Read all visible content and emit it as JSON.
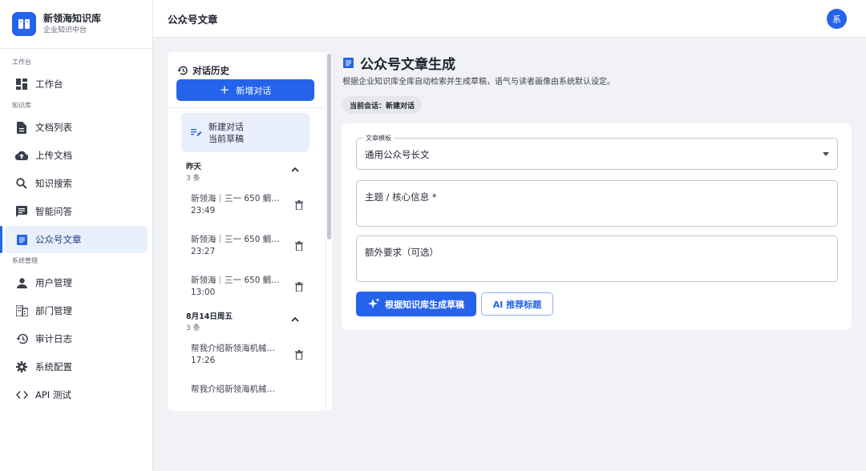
{
  "brand": {
    "name": "新领海知识库",
    "subtitle": "企业知识中台"
  },
  "sidebar": {
    "sections": [
      {
        "label": "工作台",
        "items": [
          {
            "label": "工作台",
            "icon": "dashboard-icon"
          }
        ]
      },
      {
        "label": "知识库",
        "items": [
          {
            "label": "文档列表",
            "icon": "document-icon"
          },
          {
            "label": "上传文档",
            "icon": "cloud-upload-icon"
          },
          {
            "label": "知识搜索",
            "icon": "search-icon"
          },
          {
            "label": "智能问答",
            "icon": "chat-icon"
          },
          {
            "label": "公众号文章",
            "icon": "article-icon",
            "active": true
          }
        ]
      },
      {
        "label": "系统管理",
        "items": [
          {
            "label": "用户管理",
            "icon": "user-icon"
          },
          {
            "label": "部门管理",
            "icon": "building-icon"
          },
          {
            "label": "审计日志",
            "icon": "history-icon"
          },
          {
            "label": "系统配置",
            "icon": "gear-icon"
          },
          {
            "label": "API 测试",
            "icon": "code-icon"
          }
        ]
      }
    ]
  },
  "topbar": {
    "title": "公众号文章",
    "avatar": "系"
  },
  "history": {
    "title": "对话历史",
    "new_button": "新增对话",
    "current": {
      "title": "新建对话",
      "subtitle": "当前草稿"
    },
    "groups": [
      {
        "title": "昨天",
        "count": "3 条",
        "items": [
          {
            "title": "新领海｜三一 650 鲷鱼...",
            "time": "23:49"
          },
          {
            "title": "新领海｜三一 650 鲷鱼...",
            "time": "23:27"
          },
          {
            "title": "新领海｜三一 650 鲷鱼...",
            "time": "13:00"
          }
        ]
      },
      {
        "title": "8月14日周五",
        "count": "3 条",
        "items": [
          {
            "title": "帮我介绍新领海机械化...",
            "time": "17:26"
          },
          {
            "title": "帮我介绍新领海机械化...",
            "time": ""
          }
        ]
      }
    ]
  },
  "main": {
    "title": "公众号文章生成",
    "description": "根据企业知识库全库自动检索并生成草稿，语气与读者画像由系统默认设定。",
    "session_chip": "当前会话：新建对话",
    "form": {
      "template_label": "文章模板",
      "template_value": "通用公众号长文",
      "topic_placeholder": "主题 / 核心信息 *",
      "extra_placeholder": "额外要求（可选）",
      "generate_button": "根据知识库生成草稿",
      "recommend_button": "AI 推荐标题"
    }
  },
  "colors": {
    "accent": "#2563eb",
    "active_bg": "#e9effb",
    "page_bg": "#f1f2f6"
  }
}
